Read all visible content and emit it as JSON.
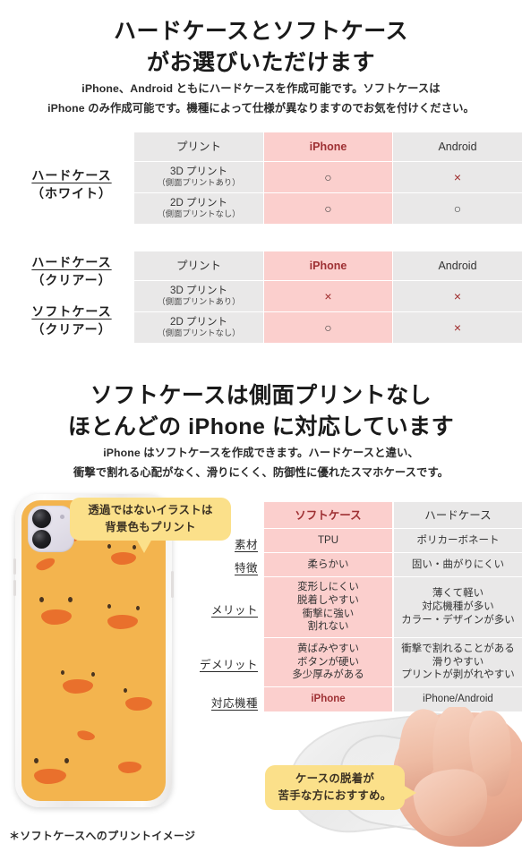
{
  "section1": {
    "title_line1": "ハードケースとソフトケース",
    "title_line2": "がお選びいただけます",
    "lead_line1": "iPhone、Android ともにハードケースを作成可能です。ソフトケースは",
    "lead_line2": "iPhone のみ作成可能です。機種によって仕様が異なりますのでお気を付けください。"
  },
  "table1": {
    "row_label_line1": "ハードケース",
    "row_label_line2": "（ホワイト）",
    "headers": [
      "プリント",
      "iPhone",
      "Android"
    ],
    "rows": [
      {
        "label_main": "3D プリント",
        "label_sub": "（側面プリントあり）",
        "iphone": "○",
        "android": "×"
      },
      {
        "label_main": "2D プリント",
        "label_sub": "（側面プリントなし）",
        "iphone": "○",
        "android": "○"
      }
    ]
  },
  "table2": {
    "row_label_a_line1": "ハードケース",
    "row_label_a_line2": "（クリアー）",
    "row_label_b_line1": "ソフトケース",
    "row_label_b_line2": "（クリアー）",
    "headers": [
      "プリント",
      "iPhone",
      "Android"
    ],
    "rows": [
      {
        "label_main": "3D プリント",
        "label_sub": "（側面プリントあり）",
        "iphone": "×",
        "android": "×"
      },
      {
        "label_main": "2D プリント",
        "label_sub": "（側面プリントなし）",
        "iphone": "○",
        "android": "×"
      }
    ]
  },
  "section2": {
    "title_line1": "ソフトケースは側面プリントなし",
    "title_line2": "ほとんどの iPhone に対応しています",
    "lead_line1": "iPhone はソフトケースを作成できます。ハードケースと違い、",
    "lead_line2": "衝撃で割れる心配がなく、滑りにくく、防御性に優れたスマホケースです。"
  },
  "compare_table": {
    "headers": [
      "ソフトケース",
      "ハードケース"
    ],
    "rows": [
      {
        "label": "素材",
        "soft": [
          "TPU"
        ],
        "hard": [
          "ポリカーボネート"
        ]
      },
      {
        "label": "特徴",
        "soft": [
          "柔らかい"
        ],
        "hard": [
          "固い・曲がりにくい"
        ]
      },
      {
        "label": "メリット",
        "soft": [
          "変形しにくい",
          "脱着しやすい",
          "衝撃に強い",
          "割れない"
        ],
        "hard": [
          "薄くて軽い",
          "対応機種が多い",
          "カラー・デザインが多い"
        ]
      },
      {
        "label": "デメリット",
        "soft": [
          "黄ばみやすい",
          "ボタンが硬い",
          "多少厚みがある"
        ],
        "hard": [
          "衝撃で割れることがある",
          "滑りやすい",
          "プリントが剥がれやすい"
        ]
      },
      {
        "label": "対応機種",
        "soft": [
          "iPhone"
        ],
        "hard": [
          "iPhone/Android"
        ]
      }
    ]
  },
  "bubbles": {
    "print_note_line1": "透過ではないイラストは",
    "print_note_line2": "背景色もプリント",
    "grip_note_line1": "ケースの脱着が",
    "grip_note_line2": "苦手な方におすすめ。"
  },
  "footnote": "＊ソフトケースへのプリントイメージ",
  "colors": {
    "pink_cell": "#fbcfcd",
    "gray_cell": "#e9e8e8",
    "pink_header_text": "#9e3033",
    "bubble_yellow": "#fbe08a",
    "mark_x": "#9e2a2a",
    "mark_o": "#3d3d3d"
  }
}
